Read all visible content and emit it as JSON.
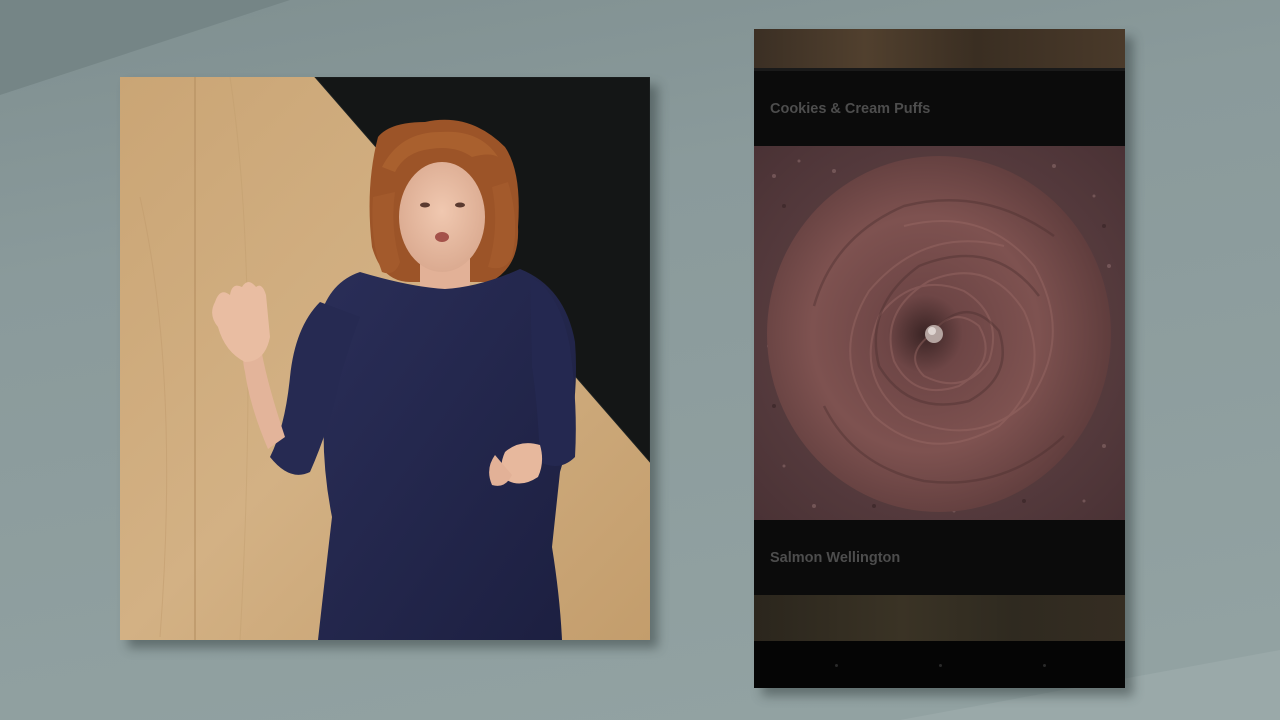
{
  "presentation": {
    "speaker_video": {
      "icon": "speaker-video-frame"
    },
    "phone_demo": {
      "recipes": [
        {
          "title": "Cookies & Cream Puffs"
        },
        {
          "title": "Salmon Wellington"
        }
      ],
      "nav_buttons": [
        "back",
        "home",
        "recents"
      ]
    }
  },
  "colors": {
    "background": "#8c9c9c",
    "phone_bg": "#050505",
    "recipe_title": "#4d4d4d",
    "dress": "#23264a",
    "hair": "#a35a2c",
    "wood": "#c9a577"
  }
}
